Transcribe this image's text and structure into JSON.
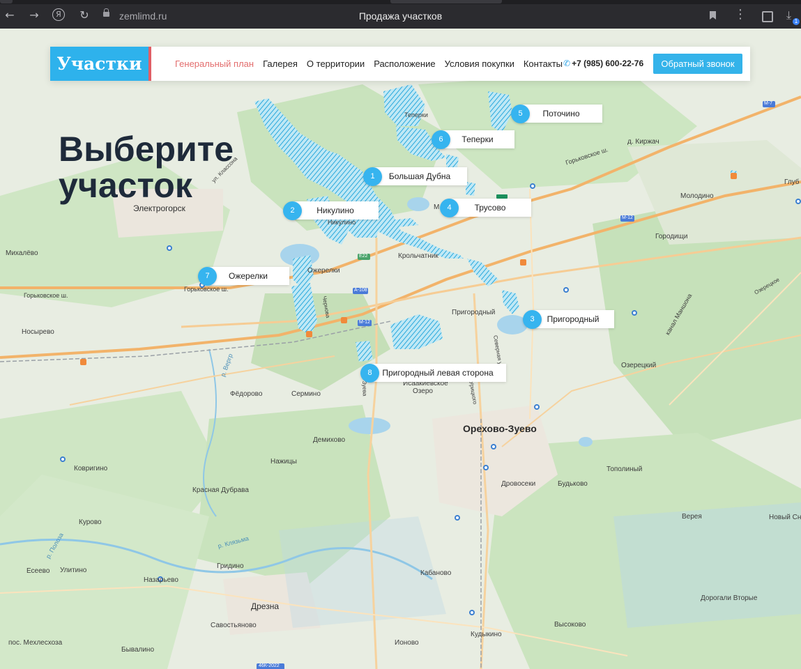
{
  "browser": {
    "url": "zemlimd.ru",
    "title": "Продажа участков",
    "back_icon": "←",
    "forward_icon": "→",
    "yandex_icon": "Я",
    "reload_icon": "↻",
    "menu_icon": "⋮",
    "download_icon": "⤓",
    "download_count": "1"
  },
  "header": {
    "logo": "Участки",
    "nav": [
      {
        "label": "Генеральный план",
        "active": true
      },
      {
        "label": "Галерея"
      },
      {
        "label": "О территории"
      },
      {
        "label": "Расположение"
      },
      {
        "label": "Условия покупки"
      },
      {
        "label": "Контакты"
      }
    ],
    "phone_icon": "✆",
    "phone": "+7 (985) 600-22-76",
    "callback": "Обратный звонок",
    "accent_color": "#34b3ea",
    "logo_border_color": "#e35d64"
  },
  "hero": {
    "line1": "Выберите",
    "line2": "участок"
  },
  "plots": [
    {
      "num": "1",
      "name": "Большая Дубна"
    },
    {
      "num": "2",
      "name": "Никулино"
    },
    {
      "num": "3",
      "name": "Пригородный"
    },
    {
      "num": "4",
      "name": "Трусово"
    },
    {
      "num": "5",
      "name": "Поточино"
    },
    {
      "num": "6",
      "name": "Теперки"
    },
    {
      "num": "7",
      "name": "Ожерелки"
    },
    {
      "num": "8",
      "name": "Пригородный левая сторона"
    }
  ],
  "map_labels": {
    "elektrogorsk": "Электрогорск",
    "mikhalevo": "Михалёво",
    "nosyrevo": "Носырево",
    "gorkovskoe1": "Горьковское ш.",
    "gorkovskoe2": "Горьковское ш.",
    "gorkovskoe3": "Горьковское ш.",
    "ozherelki": "Ожерелки",
    "krolchatnik": "Крольчатник",
    "prigorodny": "Пригородный",
    "isakievskoe": "Исаакиевское",
    "ozero": "Озеро",
    "fedorovo": "Фёдорово",
    "sermino": "Сермино",
    "demikhovo": "Демихово",
    "nazhitsy": "Нажицы",
    "kovrigino": "Ковригино",
    "krasnaya_dubrava": "Красная Дубрава",
    "kurovo": "Курово",
    "orekhovo": "Орехово-Зуево",
    "drovoseki": "Дровосеки",
    "budkovo": "Будьково",
    "topolinyy": "Тополиный",
    "vereya": "Верея",
    "novy_sn": "Новый Сн",
    "ozeretsky": "Озерецкий",
    "gorodishchi": "Городищи",
    "molodino": "Молодино",
    "glub": "Глуб",
    "d_kirzhach": "д. Киржач",
    "teperki_map": "Теперки",
    "nikulino_map": "Никулино",
    "m_village": "М",
    "eseevo": "Есеево",
    "ulitino": "Улитино",
    "nazarevo": "Назарьево",
    "gridino": "Гридино",
    "drezna": "Дрезна",
    "savostyanovo": "Савостьяново",
    "mekhlesykhoza": "пос. Мехлесхоза",
    "byvalino": "Бывалино",
    "ionovo": "Ионово",
    "kabanovo": "Кабаново",
    "kudykino": "Кудыкино",
    "vysokovo": "Высоково",
    "dorogali": "Дорогали Вторые",
    "kanal": "канал Маншона",
    "m7": "M-7",
    "m12a": "M-12",
    "m12b": "M-12",
    "e22": "E22",
    "a108": "A-108",
    "ak2022": "46К-2022",
    "r_vergr": "р. Вергр",
    "r_klyazma": "р. Клязьма",
    "r_poloza": "р. Полоза",
    "ul_klassona": "ул. Классона",
    "chernova": "Чернова",
    "severnaya": "Северная ул.",
    "uritskogo": "Урицкого",
    "zueva": "Зуева",
    "ozer_road": "Озерецкое"
  }
}
